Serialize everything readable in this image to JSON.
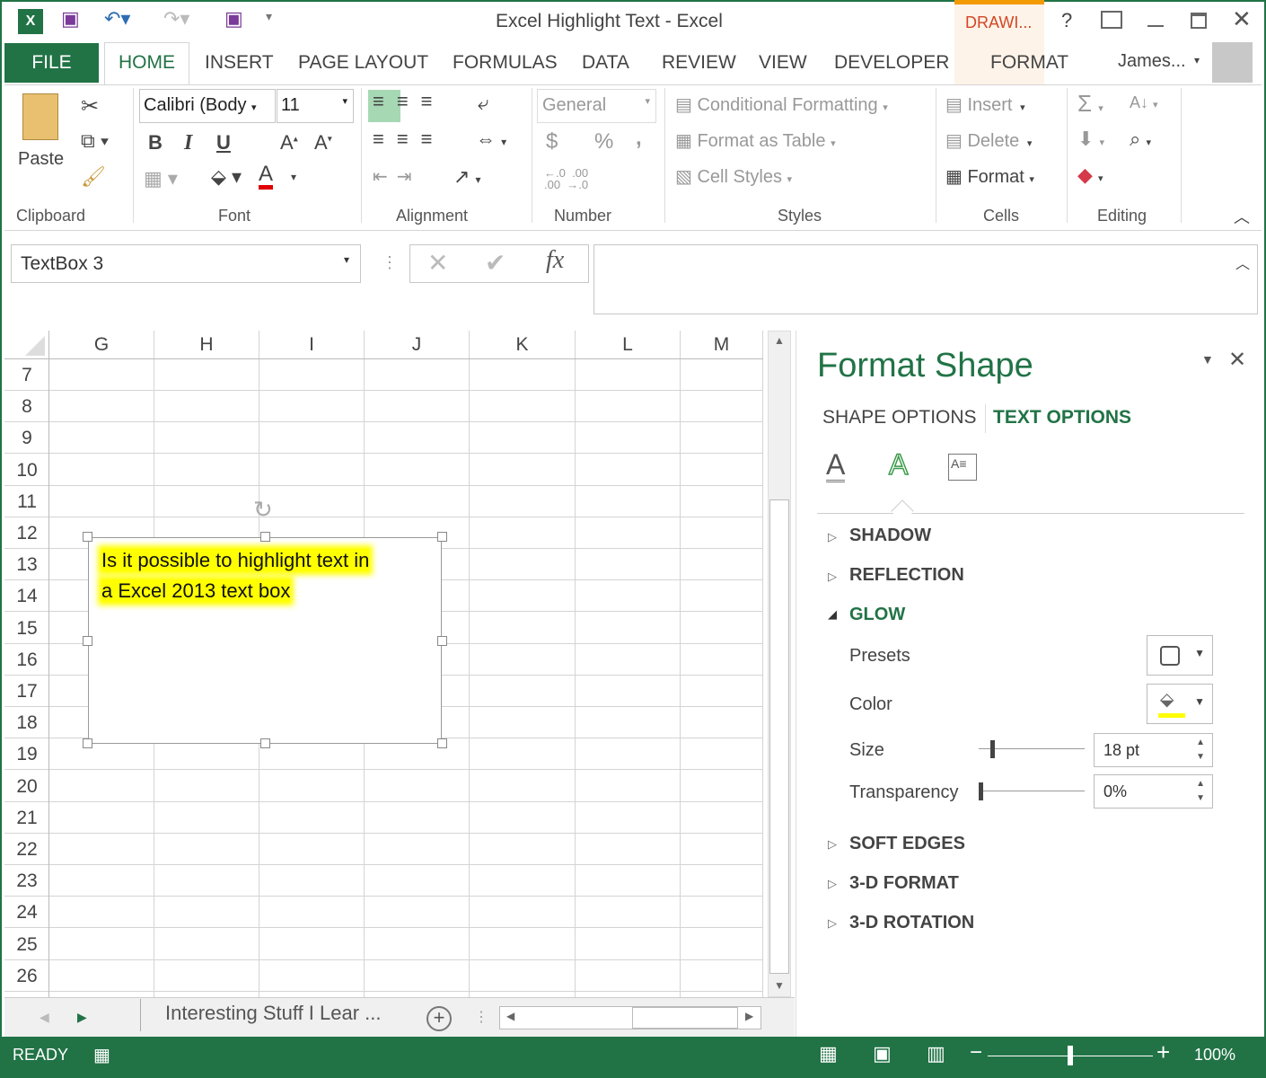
{
  "title": "Excel Highlight Text - Excel",
  "context_tab": "DRAWI...",
  "help": "?",
  "tabs": [
    "FILE",
    "HOME",
    "INSERT",
    "PAGE LAYOUT",
    "FORMULAS",
    "DATA",
    "REVIEW",
    "VIEW",
    "DEVELOPER",
    "FORMAT"
  ],
  "user": "James...",
  "ribbon": {
    "paste": "Paste",
    "font_name": "Calibri (Body",
    "font_size": "11",
    "bold": "B",
    "italic": "I",
    "underline": "U",
    "number_format": "General",
    "currency": "$",
    "percent": "%",
    "comma": ",",
    "conditional_formatting": "Conditional Formatting",
    "format_as_table": "Format as Table",
    "cell_styles": "Cell Styles",
    "insert": "Insert",
    "delete": "Delete",
    "format": "Format",
    "groups": {
      "clipboard": "Clipboard",
      "font": "Font",
      "alignment": "Alignment",
      "number": "Number",
      "styles": "Styles",
      "cells": "Cells",
      "editing": "Editing"
    }
  },
  "name_box": "TextBox 3",
  "fx": "fx",
  "columns": [
    "G",
    "H",
    "I",
    "J",
    "K",
    "L",
    "M"
  ],
  "rows": [
    "7",
    "8",
    "9",
    "10",
    "11",
    "12",
    "13",
    "14",
    "15",
    "16",
    "17",
    "18",
    "19",
    "20",
    "21",
    "22",
    "23",
    "24",
    "25",
    "26"
  ],
  "textbox": {
    "line1": "Is it possible to highlight text in",
    "line2": "a Excel 2013 text box",
    "highlight": "#ffff00"
  },
  "sheet_tab": "Interesting Stuff I Lear ...",
  "status": {
    "ready": "READY",
    "zoom": "100%",
    "zoom_fraction": 0.5
  },
  "pane": {
    "title": "Format Shape",
    "tab_shape": "SHAPE OPTIONS",
    "tab_text": "TEXT OPTIONS",
    "sections": {
      "shadow": "SHADOW",
      "reflection": "REFLECTION",
      "glow": "GLOW",
      "soft_edges": "SOFT EDGES",
      "format3d": "3-D FORMAT",
      "rotation3d": "3-D ROTATION"
    },
    "presets": "Presets",
    "color": "Color",
    "size": "Size",
    "transparency": "Transparency",
    "size_value": "18 pt",
    "transparency_value": "0%",
    "glow_color": "#ffff00"
  },
  "colors": {
    "accent": "#217346",
    "context": "#d24726"
  }
}
